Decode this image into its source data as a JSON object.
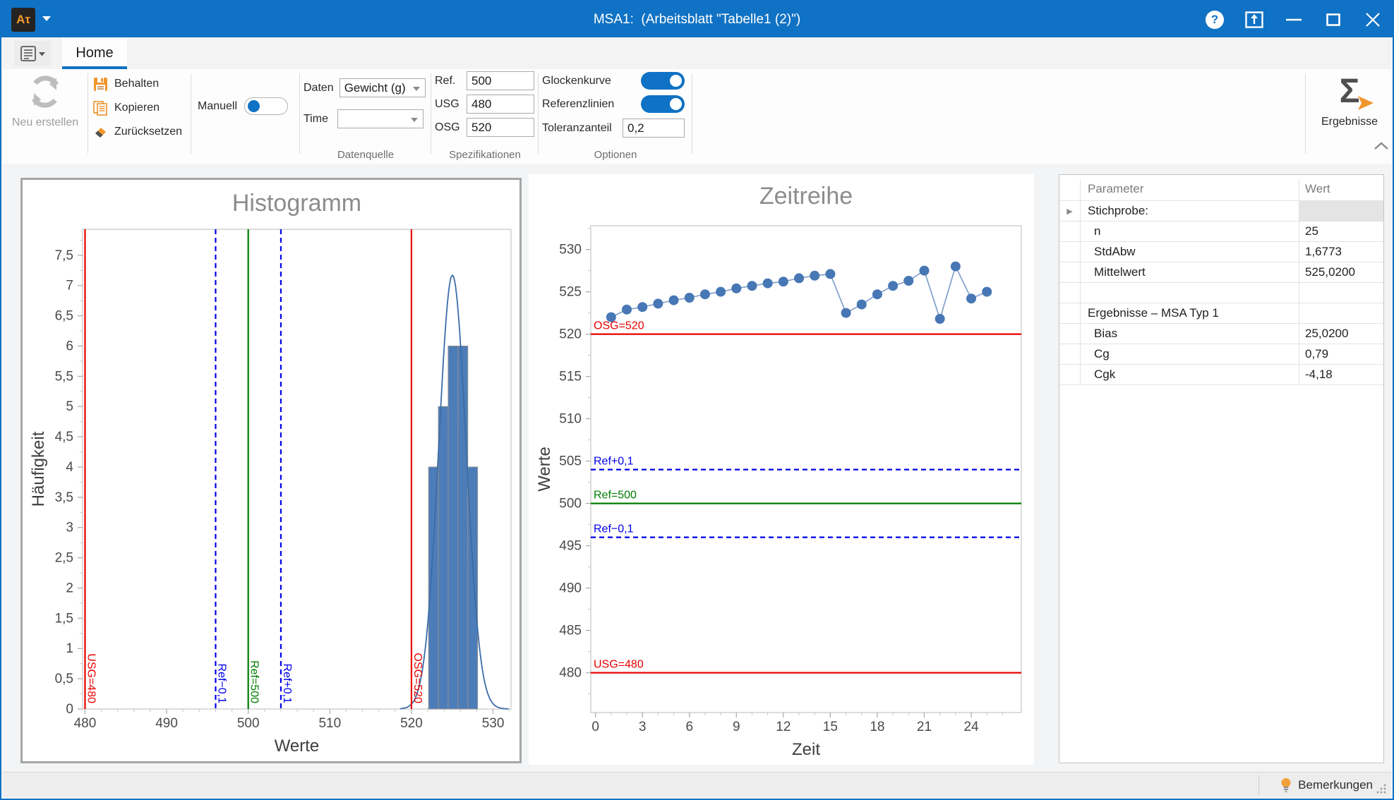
{
  "titlebar": {
    "title": "MSA1:  (Arbeitsblatt \"Tabelle1 (2)\")",
    "app_icon": "Aτ"
  },
  "ribbon": {
    "home_tab": "Home",
    "neu_erstellen": "Neu erstellen",
    "behalten": "Behalten",
    "kopieren": "Kopieren",
    "zuruecksetzen": "Zurücksetzen",
    "manuell": {
      "label": "Manuell",
      "on": false
    },
    "datenquelle": {
      "label": "Datenquelle",
      "daten_label": "Daten",
      "daten_value": "Gewicht (g)",
      "time_label": "Time",
      "time_value": ""
    },
    "spezifikationen": {
      "label": "Spezifikationen",
      "ref_label": "Ref.",
      "ref_value": "500",
      "usg_label": "USG",
      "usg_value": "480",
      "osg_label": "OSG",
      "osg_value": "520"
    },
    "optionen": {
      "label": "Optionen",
      "glockenkurve_label": "Glockenkurve",
      "glockenkurve_on": true,
      "referenzlinien_label": "Referenzlinien",
      "referenzlinien_on": true,
      "toleranzanteil_label": "Toleranzanteil",
      "toleranzanteil_value": "0,2"
    },
    "ergebnisse": "Ergebnisse"
  },
  "results_table": {
    "headers": [
      "Parameter",
      "Wert"
    ],
    "rows": [
      {
        "label": "Stichprobe:",
        "value": "",
        "kind": "group",
        "expander": true,
        "value_shaded": true
      },
      {
        "label": "n",
        "value": "25",
        "kind": "item"
      },
      {
        "label": "StdAbw",
        "value": "1,6773",
        "kind": "item"
      },
      {
        "label": "Mittelwert",
        "value": "525,0200",
        "kind": "item"
      },
      {
        "label": "",
        "value": "",
        "kind": "empty"
      },
      {
        "label": "Ergebnisse – MSA Typ 1",
        "value": "",
        "kind": "group"
      },
      {
        "label": "Bias",
        "value": "25,0200",
        "kind": "item"
      },
      {
        "label": "Cg",
        "value": "0,79",
        "kind": "item"
      },
      {
        "label": "Cgk",
        "value": "-4,18",
        "kind": "item"
      }
    ]
  },
  "statusbar": {
    "bemerkungen": "Bemerkungen"
  },
  "colors": {
    "titlebar": "#1072c4",
    "accent": "#1072c4",
    "ref_red": "#e80000",
    "ref_green": "#007d00",
    "ref_blue": "#0000e8",
    "bar_fill": "#4d7db8",
    "bar_border": "#8f8f8f",
    "curve": "#3c6ca8",
    "series_line": "#7b9cc7",
    "series_marker": "#4777b4",
    "spine": "#c6c6c6",
    "tick_label": "#4a4a4a",
    "chart_title": "#8c8c8c"
  },
  "chart_data": [
    {
      "type": "bar",
      "variant": "histogram",
      "title": "Histogramm",
      "xlabel": "Werte",
      "ylabel": "Häufigkeit",
      "xlim": [
        479.7,
        532.2
      ],
      "ylim": [
        0,
        7.93
      ],
      "xticks": [
        480,
        490,
        500,
        510,
        520,
        530
      ],
      "yticks": [
        0,
        0.5,
        1,
        1.5,
        2,
        2.5,
        3,
        3.5,
        4,
        4.5,
        5,
        5.5,
        6,
        6.5,
        7,
        7.5
      ],
      "ytick_labels": [
        "0",
        "0,5",
        "1",
        "1,5",
        "2",
        "2,5",
        "3",
        "3,5",
        "4",
        "4,5",
        "5",
        "5,5",
        "6",
        "6,5",
        "7",
        "7,5"
      ],
      "bin_edges": [
        522.1,
        523.3,
        524.5,
        525.7,
        526.9,
        528.1
      ],
      "bin_heights": [
        4,
        5,
        6,
        6,
        4
      ],
      "bell_curve": {
        "mean": 525.02,
        "sd": 1.6773,
        "peak": 7.17
      },
      "ref_lines": [
        {
          "x": 480,
          "label": "USG=480",
          "color": "red",
          "dashed": false
        },
        {
          "x": 496,
          "label": "Ref−0,1",
          "color": "blue",
          "dashed": true
        },
        {
          "x": 500,
          "label": "Ref=500",
          "color": "green",
          "dashed": false
        },
        {
          "x": 504,
          "label": "Ref+0,1",
          "color": "blue",
          "dashed": true
        },
        {
          "x": 520,
          "label": "OSG=520",
          "color": "red",
          "dashed": false
        }
      ]
    },
    {
      "type": "line",
      "title": "Zeitreihe",
      "xlabel": "Zeit",
      "ylabel": "Werte",
      "xlim": [
        -0.3,
        27.2
      ],
      "ylim": [
        475.3,
        532.8
      ],
      "xticks": [
        0,
        3,
        6,
        9,
        12,
        15,
        18,
        21,
        24
      ],
      "yticks": [
        480,
        485,
        490,
        495,
        500,
        505,
        510,
        515,
        520,
        525,
        530
      ],
      "x": [
        1,
        2,
        3,
        4,
        5,
        6,
        7,
        8,
        9,
        10,
        11,
        12,
        13,
        14,
        15,
        16,
        17,
        18,
        19,
        20,
        21,
        22,
        23,
        24,
        25
      ],
      "y": [
        522.0,
        522.9,
        523.2,
        523.6,
        524.0,
        524.3,
        524.7,
        525.0,
        525.4,
        525.7,
        526.0,
        526.2,
        526.6,
        526.9,
        527.1,
        522.5,
        523.5,
        524.7,
        525.7,
        526.3,
        527.5,
        521.8,
        528.0,
        524.2,
        525.0
      ],
      "ref_lines": [
        {
          "y": 520,
          "label": "OSG=520",
          "color": "red",
          "dashed": false
        },
        {
          "y": 504,
          "label": "Ref+0,1",
          "color": "blue",
          "dashed": true
        },
        {
          "y": 500,
          "label": "Ref=500",
          "color": "green",
          "dashed": false
        },
        {
          "y": 496,
          "label": "Ref−0,1",
          "color": "blue",
          "dashed": true
        },
        {
          "y": 480,
          "label": "USG=480",
          "color": "red",
          "dashed": false
        }
      ]
    }
  ]
}
